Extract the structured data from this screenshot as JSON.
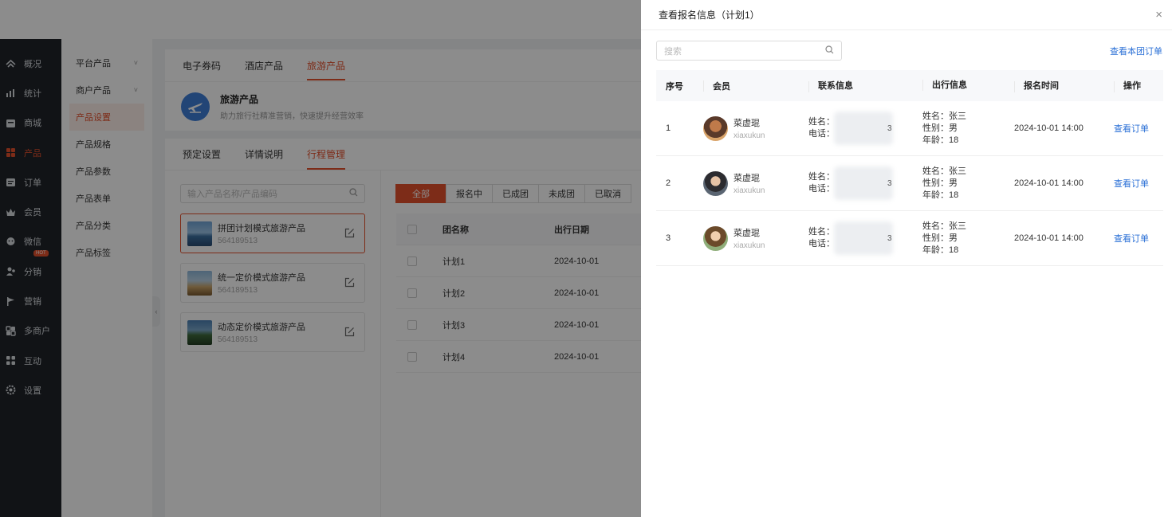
{
  "sidebar": {
    "items": [
      {
        "label": "概况",
        "icon": "dashboard-icon"
      },
      {
        "label": "统计",
        "icon": "stats-icon"
      },
      {
        "label": "商城",
        "icon": "store-icon"
      },
      {
        "label": "产品",
        "icon": "product-icon",
        "active": true
      },
      {
        "label": "订单",
        "icon": "order-icon"
      },
      {
        "label": "会员",
        "icon": "member-icon"
      },
      {
        "label": "微信",
        "icon": "wechat-icon"
      },
      {
        "label": "分销",
        "icon": "distribution-icon"
      },
      {
        "label": "营销",
        "icon": "marketing-icon",
        "badge": "HOT"
      },
      {
        "label": "多商户",
        "icon": "merchant-icon"
      },
      {
        "label": "互动",
        "icon": "interact-icon"
      },
      {
        "label": "设置",
        "icon": "settings-icon"
      }
    ]
  },
  "submenu": {
    "items": [
      {
        "label": "平台产品",
        "chevron": "˅"
      },
      {
        "label": "商户产品",
        "chevron": "˅"
      },
      {
        "label": "产品设置",
        "active": true
      },
      {
        "label": "产品规格"
      },
      {
        "label": "产品参数"
      },
      {
        "label": "产品表单"
      },
      {
        "label": "产品分类"
      },
      {
        "label": "产品标签"
      }
    ]
  },
  "main": {
    "tabs": [
      "电子券码",
      "酒店产品",
      "旅游产品"
    ],
    "banner": {
      "title": "旅游产品",
      "subtitle": "助力旅行社精准营销，快速提升经营效率"
    },
    "subtabs": [
      "预定设置",
      "详情说明",
      "行程管理"
    ],
    "product_search_placeholder": "输入产品名称/产品编码",
    "products": [
      {
        "name": "拼团计划模式旅游产品",
        "code": "564189513"
      },
      {
        "name": "统一定价模式旅游产品",
        "code": "564189513"
      },
      {
        "name": "动态定价模式旅游产品",
        "code": "564189513"
      }
    ],
    "status_filters": [
      "全部",
      "报名中",
      "已成团",
      "未成团",
      "已取消"
    ],
    "group_table": {
      "headers": [
        "团名称",
        "出行日期"
      ],
      "rows": [
        {
          "name": "计划1",
          "date": "2024-10-01"
        },
        {
          "name": "计划2",
          "date": "2024-10-01"
        },
        {
          "name": "计划3",
          "date": "2024-10-01"
        },
        {
          "name": "计划4",
          "date": "2024-10-01"
        }
      ]
    }
  },
  "drawer": {
    "title": "查看报名信息（计划1）",
    "close": "×",
    "search_placeholder": "搜索",
    "view_group_orders": "查看本团订单",
    "headers": [
      "序号",
      "会员",
      "联系信息",
      "出行信息",
      "报名时间",
      "操作"
    ],
    "rows": [
      {
        "no": "1",
        "member_name": "菜虚琨",
        "member_id": "xiaxukun",
        "contact_name": "姓名：",
        "contact_phone": "电话：",
        "phone_tail": "3",
        "travel_name": "姓名：张三",
        "travel_gender": "性别：男",
        "travel_age": "年龄：18",
        "time": "2024-10-01 14:00",
        "op": "查看订单"
      },
      {
        "no": "2",
        "member_name": "菜虚琨",
        "member_id": "xiaxukun",
        "contact_name": "姓名：",
        "contact_phone": "电话：",
        "phone_tail": "3",
        "travel_name": "姓名：张三",
        "travel_gender": "性别：男",
        "travel_age": "年龄：18",
        "time": "2024-10-01 14:00",
        "op": "查看订单"
      },
      {
        "no": "3",
        "member_name": "菜虚琨",
        "member_id": "xiaxukun",
        "contact_name": "姓名：",
        "contact_phone": "电话：",
        "phone_tail": "3",
        "travel_name": "姓名：张三",
        "travel_gender": "性别：男",
        "travel_age": "年龄：18",
        "time": "2024-10-01 14:00",
        "op": "查看订单"
      }
    ]
  },
  "colors": {
    "accent": "#e4502d",
    "link": "#2a6fd6",
    "sidebar_bg": "#1f2329"
  }
}
